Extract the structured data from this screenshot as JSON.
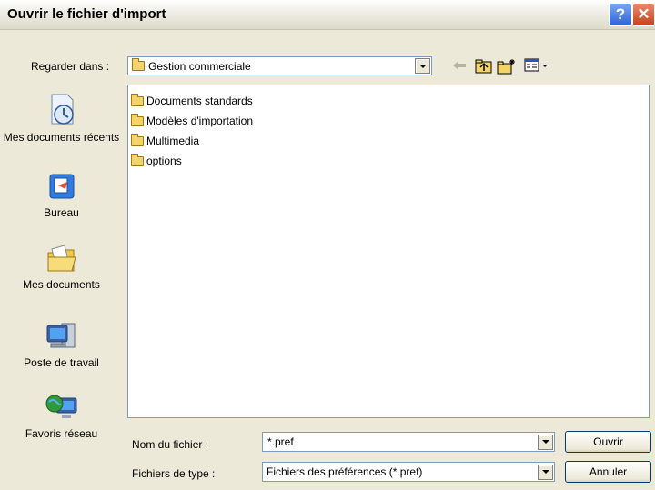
{
  "window": {
    "title": "Ouvrir le fichier d'import",
    "help_label": "?",
    "close_label": "✕"
  },
  "lookin": {
    "label": "Regarder dans :",
    "value": "Gestion commerciale"
  },
  "places": [
    {
      "label": "Mes documents récents",
      "icon": "recent-documents-icon"
    },
    {
      "label": "Bureau",
      "icon": "desktop-icon"
    },
    {
      "label": "Mes documents",
      "icon": "my-documents-icon"
    },
    {
      "label": "Poste de travail",
      "icon": "my-computer-icon"
    },
    {
      "label": "Favoris réseau",
      "icon": "network-places-icon"
    }
  ],
  "files": [
    {
      "name": "Documents standards",
      "icon": "folder-icon"
    },
    {
      "name": "Modèles d'importation",
      "icon": "folder-icon"
    },
    {
      "name": "Multimedia",
      "icon": "folder-icon"
    },
    {
      "name": "options",
      "icon": "folder-icon"
    }
  ],
  "filename": {
    "label": "Nom du fichier :",
    "value": "*.pref"
  },
  "filetype": {
    "label": "Fichiers de type :",
    "value": "Fichiers des préférences (*.pref)"
  },
  "buttons": {
    "open": "Ouvrir",
    "cancel": "Annuler"
  }
}
